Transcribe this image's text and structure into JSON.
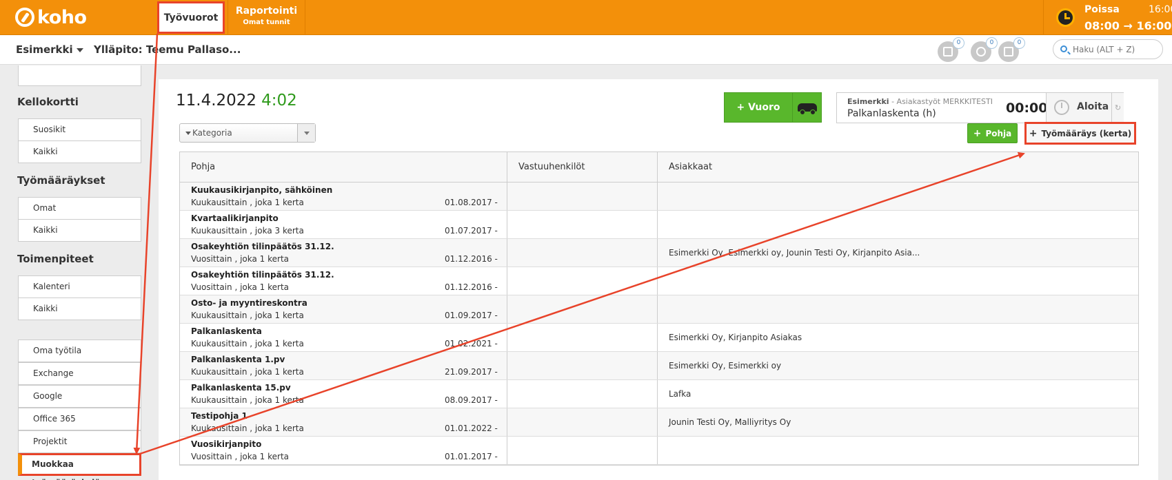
{
  "brand": {
    "name": "koho"
  },
  "topbar": {
    "tabs": [
      {
        "label": "Työvuorot"
      },
      {
        "label": "Raportointi",
        "sublabel": "Omat tunnit"
      }
    ],
    "status": {
      "label": "Poissa",
      "time": "16:00",
      "range": "08:00 → 16:00"
    }
  },
  "subbar": {
    "company": "Esimerkki",
    "admin": "Ylläpito: Teemu Pallaso...",
    "notifications": [
      {
        "icon": "ticket-icon",
        "count": "0"
      },
      {
        "icon": "people-icon",
        "count": "0"
      },
      {
        "icon": "list-icon",
        "count": "0"
      }
    ],
    "search": {
      "placeholder": "Haku (ALT + Z)"
    }
  },
  "sidebar": {
    "sections": [
      {
        "heading": "Kellokortti",
        "items": [
          "Suosikit",
          "Kaikki"
        ]
      },
      {
        "heading": "Työmääräykset",
        "items": [
          "Omat",
          "Kaikki"
        ]
      },
      {
        "heading": "Toimenpiteet",
        "items": [
          "Kalenteri",
          "Kaikki"
        ]
      }
    ],
    "links": [
      "Oma työtila",
      "Exchange",
      "Google",
      "Office 365",
      "Projektit",
      "Muokkaa työmääräyksiä"
    ],
    "active": "Muokkaa työmääräyksiä"
  },
  "main": {
    "date": "11.4.2022",
    "time": "4:02",
    "vuoro_button": "+ Vuoro",
    "timer": {
      "company": "Esimerkki",
      "context": " - Asiakastyöt MERKKITESTI",
      "task": "Palkanlaskenta (h)",
      "elapsed": "00:00",
      "start_label": "Aloita"
    },
    "category_select": "Kategoria",
    "pohja_button": "Pohja",
    "tyomaarays_button": "Työmääräys (kerta)",
    "table": {
      "headers": [
        "Pohja",
        "Vastuuhenkilöt",
        "Asiakkaat"
      ],
      "rows": [
        {
          "name": "Kuukausikirjanpito, sähköinen",
          "freq": "Kuukausittain , joka 1 kerta",
          "date": "01.08.2017 -",
          "owners": "",
          "clients": ""
        },
        {
          "name": "Kvartaalikirjanpito",
          "freq": "Kuukausittain , joka 3 kerta",
          "date": "01.07.2017 -",
          "owners": "",
          "clients": ""
        },
        {
          "name": "Osakeyhtiön tilinpäätös 31.12.",
          "freq": "Vuosittain , joka 1 kerta",
          "date": "01.12.2016 -",
          "owners": "",
          "clients": "Esimerkki Oy, Esimerkki oy, Jounin Testi Oy, Kirjanpito Asia..."
        },
        {
          "name": "Osakeyhtiön tilinpäätös 31.12.",
          "freq": "Vuosittain , joka 1 kerta",
          "date": "01.12.2016 -",
          "owners": "",
          "clients": ""
        },
        {
          "name": "Osto- ja myyntireskontra",
          "freq": "Kuukausittain , joka 1 kerta",
          "date": "01.09.2017 -",
          "owners": "",
          "clients": ""
        },
        {
          "name": "Palkanlaskenta",
          "freq": "Kuukausittain , joka 1 kerta",
          "date": "01.02.2021 -",
          "owners": "",
          "clients": "Esimerkki Oy, Kirjanpito Asiakas"
        },
        {
          "name": "Palkanlaskenta 1.pv",
          "freq": "Kuukausittain , joka 1 kerta",
          "date": "21.09.2017 -",
          "owners": "",
          "clients": "Esimerkki Oy, Esimerkki oy"
        },
        {
          "name": "Palkanlaskenta 15.pv",
          "freq": "Kuukausittain , joka 1 kerta",
          "date": "08.09.2017 -",
          "owners": "",
          "clients": "Lafka"
        },
        {
          "name": "Testipohja 1",
          "freq": "Kuukausittain , joka 1 kerta",
          "date": "01.01.2022 -",
          "owners": "",
          "clients": "Jounin Testi Oy, Malliyritys Oy"
        },
        {
          "name": "Vuosikirjanpito",
          "freq": "Vuosittain , joka 1 kerta",
          "date": "01.01.2017 -",
          "owners": "",
          "clients": ""
        }
      ]
    }
  },
  "colors": {
    "brand_orange": "#f3900a",
    "annotation_red": "#e8432a",
    "action_green": "#59b72c",
    "time_green": "#2f9a1c"
  }
}
